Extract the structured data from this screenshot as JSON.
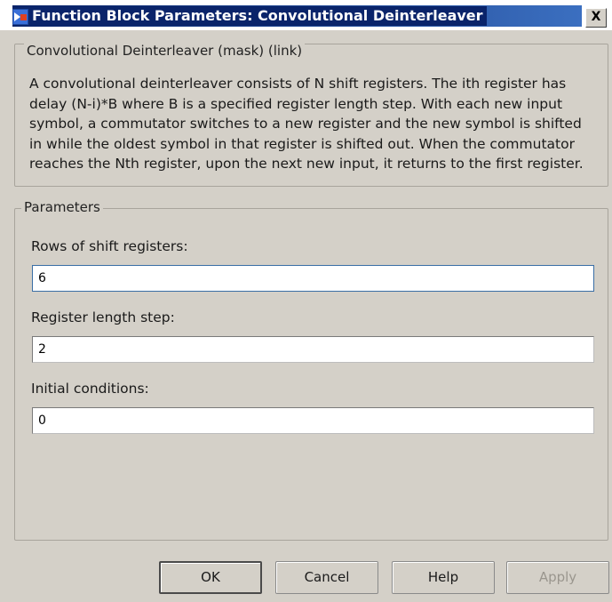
{
  "window": {
    "title": "Function Block Parameters: Convolutional Deinterleaver",
    "close_label": "X",
    "icon": "simulink-block-icon"
  },
  "description_group": {
    "legend": "Convolutional Deinterleaver (mask) (link)",
    "text": "A convolutional deinterleaver consists of N shift registers.  The ith register has delay (N-i)*B where B is a specified register length step.  With each new input symbol, a commutator switches to a new register and the new symbol is shifted in while the oldest symbol in that register is shifted out.  When the commutator reaches the Nth register, upon the next new input, it returns to the first register."
  },
  "parameters_group": {
    "legend": "Parameters",
    "fields": [
      {
        "label": "Rows of shift registers:",
        "value": "6"
      },
      {
        "label": "Register length step:",
        "value": "2"
      },
      {
        "label": "Initial conditions:",
        "value": "0"
      }
    ]
  },
  "buttons": {
    "ok": "OK",
    "cancel": "Cancel",
    "help": "Help",
    "apply": "Apply"
  },
  "colors": {
    "dialog_bg": "#d4d0c8",
    "title_bar": "#0a246a"
  }
}
